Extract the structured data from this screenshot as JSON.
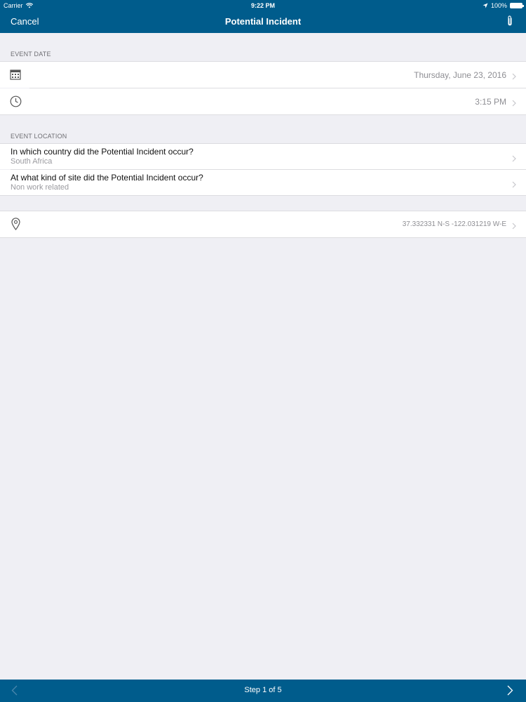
{
  "status_bar": {
    "carrier": "Carrier",
    "time": "9:22 PM",
    "battery": "100%"
  },
  "nav": {
    "cancel_label": "Cancel",
    "title": "Potential Incident"
  },
  "event_date": {
    "header": "EVENT DATE",
    "date_value": "Thursday, June 23, 2016",
    "time_value": "3:15 PM"
  },
  "event_location": {
    "header": "EVENT LOCATION",
    "questions": [
      {
        "question": "In which country did the Potential Incident occur?",
        "answer": "South Africa"
      },
      {
        "question": "At what kind of site did the Potential Incident occur?",
        "answer": "Non work related"
      }
    ]
  },
  "gps": {
    "coordinates": "37.332331 N-S -122.031219 W-E"
  },
  "toolbar": {
    "step_label": "Step 1 of 5"
  },
  "colors": {
    "brand": "#005c8c",
    "background": "#efeff4",
    "secondary_text": "#8e8e93"
  }
}
